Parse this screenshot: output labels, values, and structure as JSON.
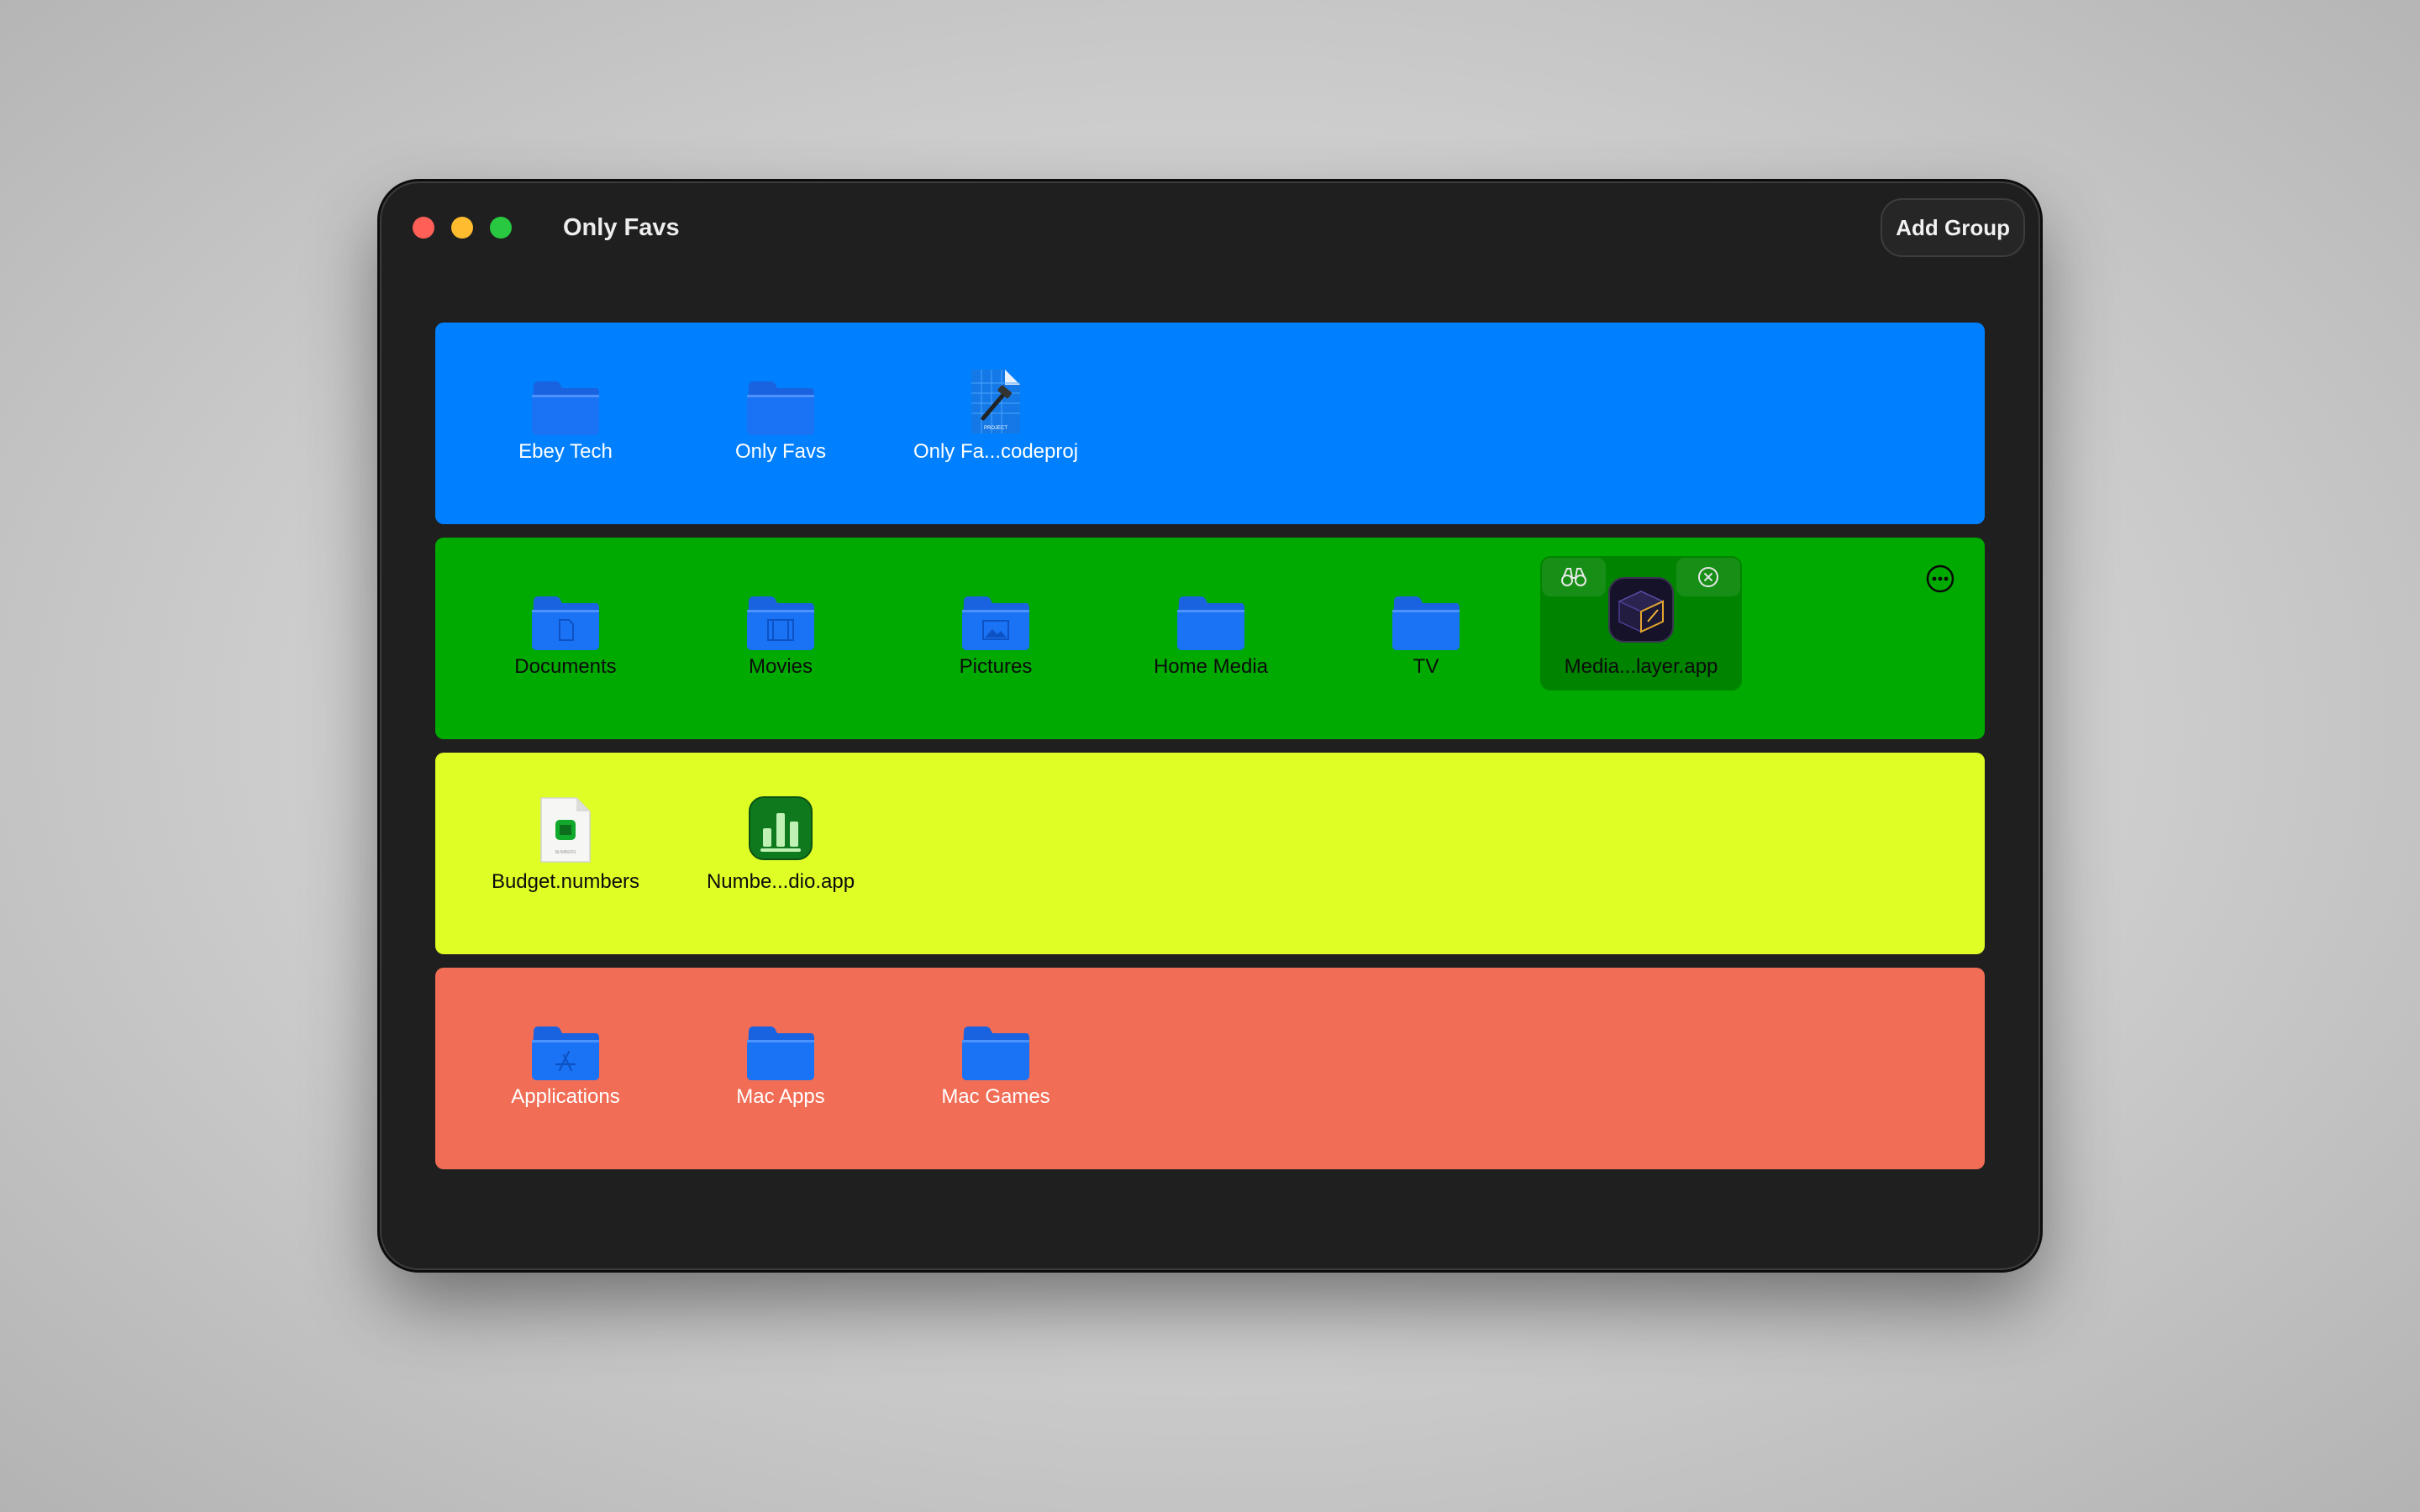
{
  "window": {
    "title": "Only Favs",
    "add_group_label": "Add Group"
  },
  "groups": [
    {
      "color": "#0080fe",
      "items": [
        {
          "label": "Ebey Tech",
          "icon": "folder-icon"
        },
        {
          "label": "Only Favs",
          "icon": "folder-icon"
        },
        {
          "label": "Only Fa...codeproj",
          "icon": "xcode-project-icon",
          "badge": "PROJECT"
        }
      ]
    },
    {
      "color": "#00aa00",
      "items": [
        {
          "label": "Documents",
          "icon": "documents-folder-icon"
        },
        {
          "label": "Movies",
          "icon": "movies-folder-icon"
        },
        {
          "label": "Pictures",
          "icon": "pictures-folder-icon"
        },
        {
          "label": "Home Media",
          "icon": "folder-icon"
        },
        {
          "label": "TV",
          "icon": "folder-icon"
        },
        {
          "label": "Media...layer.app",
          "icon": "media-player-app-icon",
          "selected": true,
          "actions": [
            "reveal-binoculars-icon",
            "remove-x-icon"
          ]
        }
      ],
      "menu_icon": "more-ellipsis-icon"
    },
    {
      "color": "#dffe26",
      "items": [
        {
          "label": "Budget.numbers",
          "icon": "numbers-document-icon",
          "badge": "NUMBERS"
        },
        {
          "label": "Numbe...dio.app",
          "icon": "numbers-app-icon"
        }
      ]
    },
    {
      "color": "#f26d56",
      "items": [
        {
          "label": "Applications",
          "icon": "applications-folder-icon"
        },
        {
          "label": "Mac Apps",
          "icon": "folder-icon"
        },
        {
          "label": "Mac Games",
          "icon": "folder-icon"
        }
      ]
    }
  ]
}
